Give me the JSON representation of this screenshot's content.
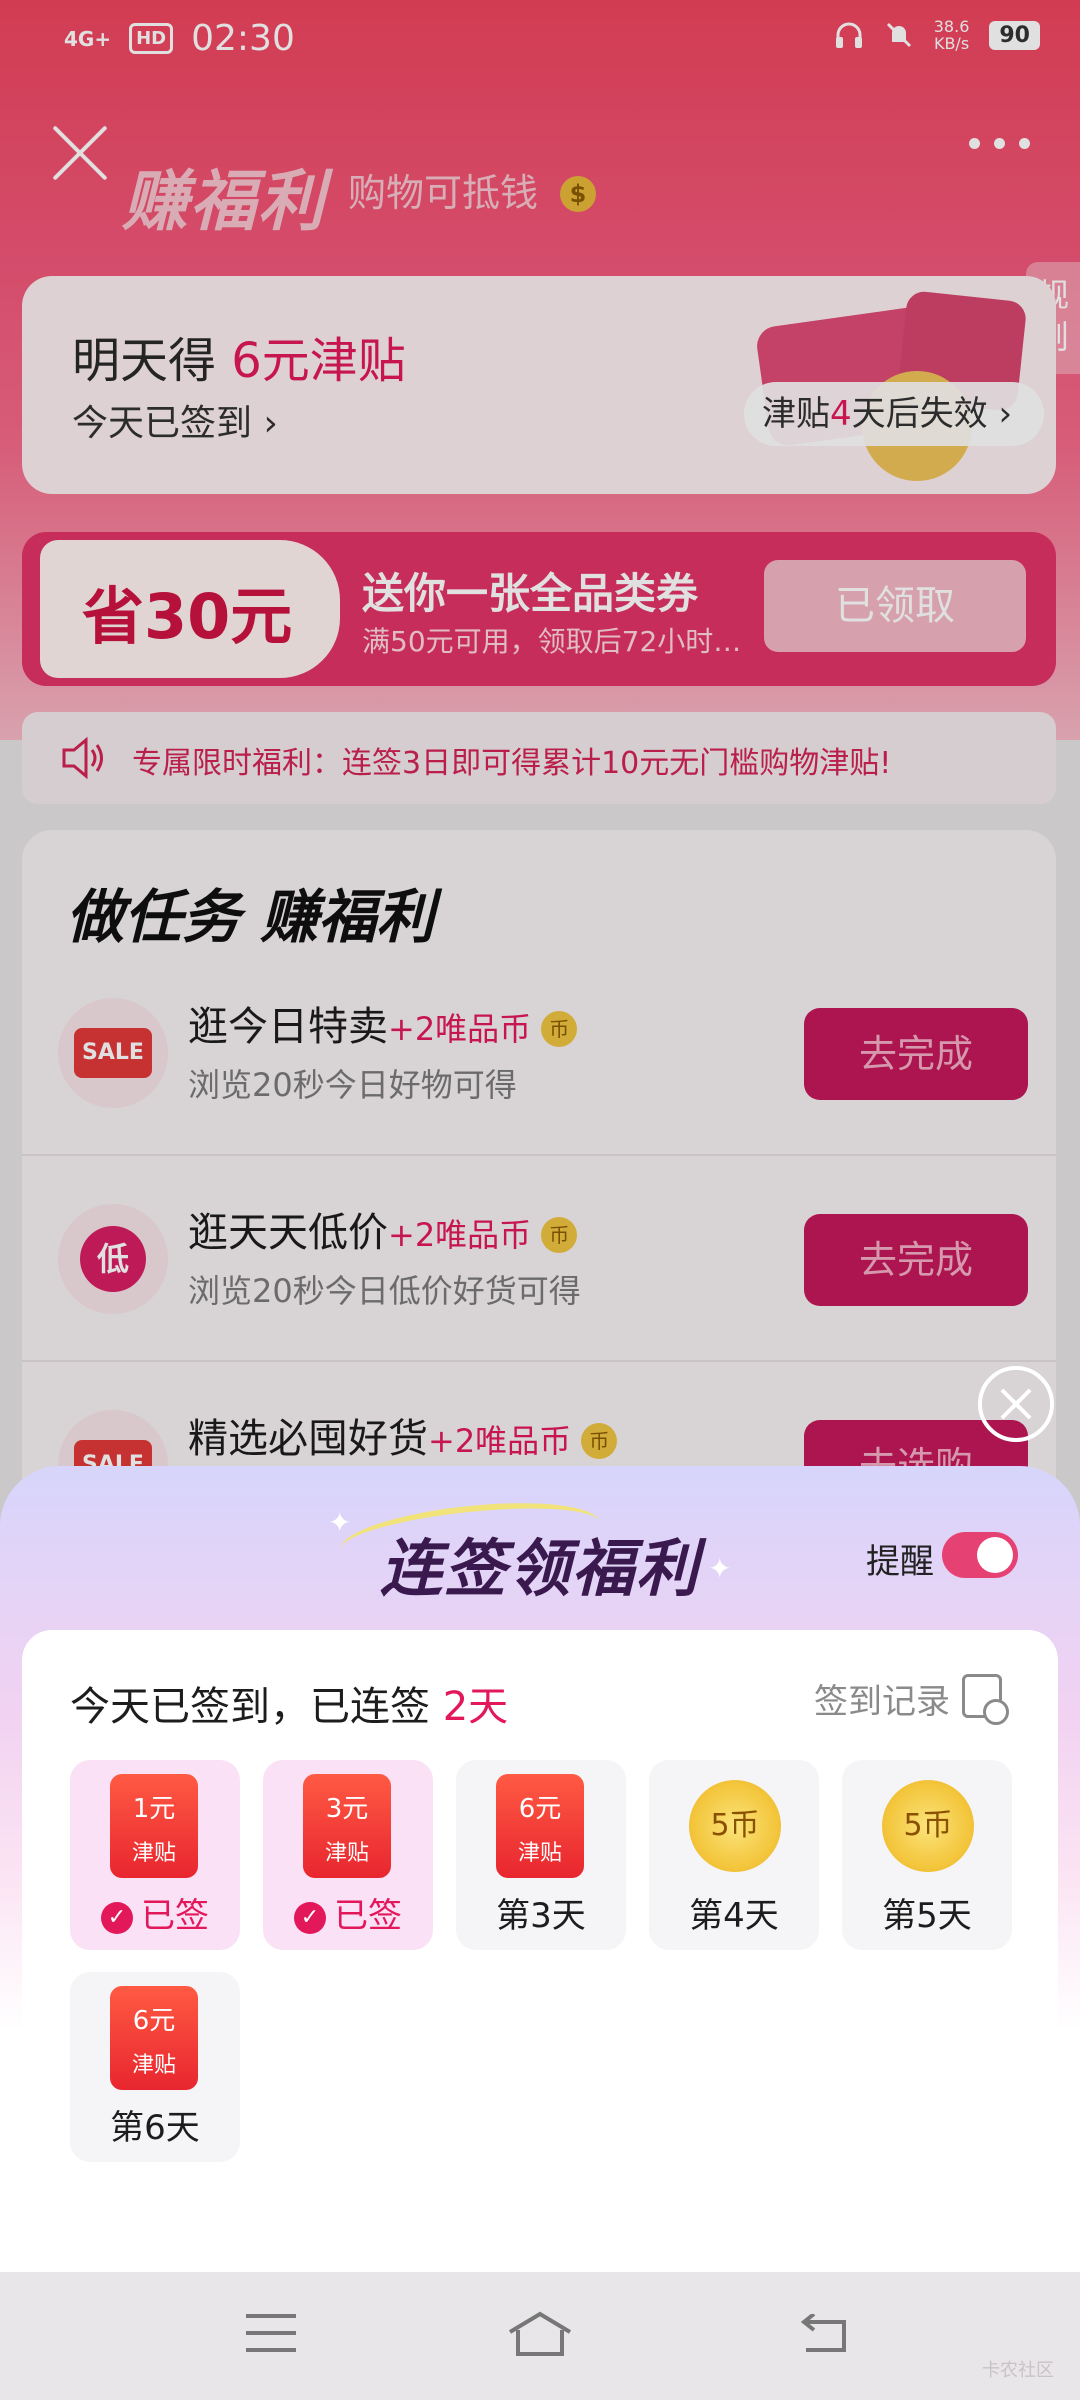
{
  "status_bar": {
    "network": "4G+",
    "hd": "HD",
    "time": "02:30",
    "speed": "38.6",
    "speed_unit": "KB/s",
    "battery": "90"
  },
  "header": {
    "title": "赚福利",
    "subtitle": "购物可抵钱",
    "coin_glyph": "$",
    "rules_label": "规则"
  },
  "subsidy_card": {
    "title_prefix": "明天得 ",
    "title_highlight": "6元津贴",
    "checked_in": "今天已签到",
    "expire_prefix": "津贴",
    "expire_highlight": "4",
    "expire_suffix": "天后失效"
  },
  "coupon": {
    "amount": "省30元",
    "title": "送你一张全品类券",
    "desc": "满50元可用，领取后72小时…",
    "button": "已领取"
  },
  "notice": {
    "text": "专属限时福利：连签3日即可得累计10元无门槛购物津贴!"
  },
  "tasks": {
    "title": "做任务 赚福利",
    "items": [
      {
        "badge": "SALE",
        "name": "逛今日特卖",
        "reward": "+2唯品币",
        "coin": "币",
        "desc": "浏览20秒今日好物可得",
        "button": "去完成"
      },
      {
        "badge": "低",
        "name": "逛天天低价",
        "reward": "+2唯品币",
        "coin": "币",
        "desc": "浏览20秒今日低价好货可得",
        "button": "去完成"
      },
      {
        "badge": "SALE",
        "name": "精选必囤好货",
        "reward": "+2唯品币",
        "coin": "币",
        "desc": "",
        "button": "去选购"
      }
    ]
  },
  "sheet": {
    "title": "连签领福利",
    "remind_label": "提醒",
    "remind_on": true,
    "streak_prefix": "今天已签到，已连签 ",
    "streak_days": "2天",
    "record_label": "签到记录",
    "days": [
      {
        "type": "ticket",
        "amount": "1元",
        "ticket_label": "津贴",
        "label": "已签",
        "signed": true
      },
      {
        "type": "ticket",
        "amount": "3元",
        "ticket_label": "津贴",
        "label": "已签",
        "signed": true
      },
      {
        "type": "ticket",
        "amount": "6元",
        "ticket_label": "津贴",
        "label": "第3天",
        "signed": false
      },
      {
        "type": "coin",
        "amount": "5币",
        "label": "第4天",
        "signed": false
      },
      {
        "type": "coin",
        "amount": "5币",
        "label": "第5天",
        "signed": false
      },
      {
        "type": "ticket",
        "amount": "6元",
        "ticket_label": "津贴",
        "label": "第6天",
        "signed": false
      }
    ]
  },
  "watermark": "卡农社区",
  "colors": {
    "accent": "#e2185b",
    "hero": "#f0455e",
    "task_button": "#c4195a"
  }
}
